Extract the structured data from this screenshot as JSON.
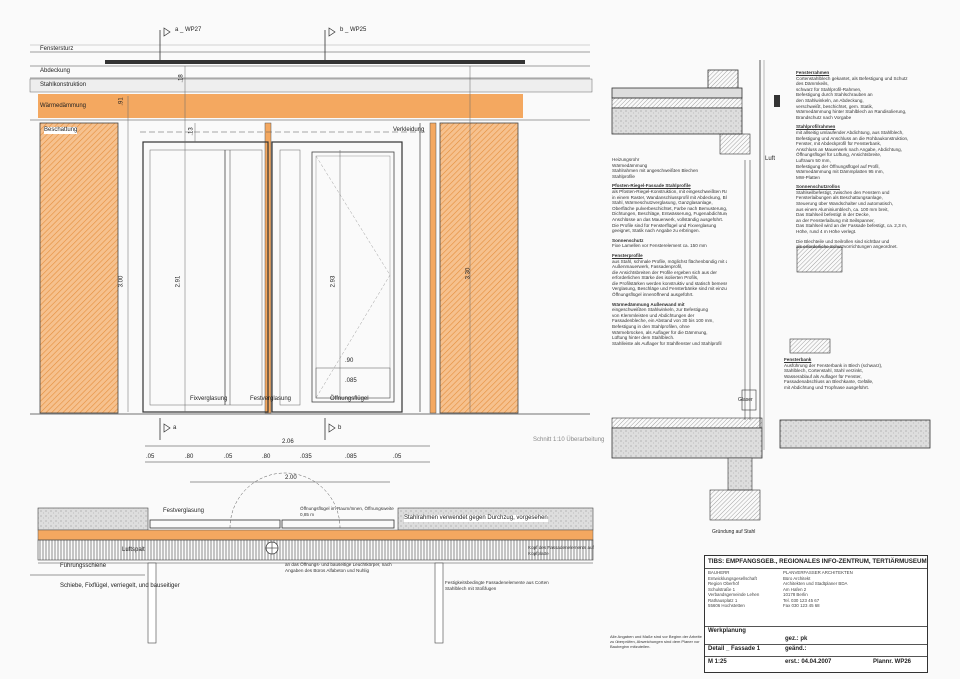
{
  "elevation": {
    "section_marks": [
      "a _ WP27",
      "b _ WP25"
    ],
    "layers": {
      "fenstersturz": "Fenstersturz",
      "abdeckung": "Abdeckung",
      "stahlkonstruktion": "Stahlkonstruktion",
      "daemmung": "Wärmedämmung",
      "beschattung": "Beschattung"
    },
    "labels": {
      "verkleidung": "Verkleidung",
      "verglasung_left": "Fixverglasung",
      "verglasung_mid": "Festverglasung",
      "oeffnungsfluegel": "Öffnungsflügel",
      "detail_ref": "Schnitt 1:10 Überarbeitung",
      "bottom_mark_a": "a",
      "bottom_mark_b": "b"
    },
    "dims_vertical": [
      ".91",
      ".18",
      ".13",
      "3.00",
      "2.91",
      "2.93",
      "3.30"
    ],
    "dims_small": [
      ".90",
      ".085"
    ],
    "dim_total": "2.06",
    "dims_row": [
      ".05",
      ".80",
      ".05",
      ".80",
      ".035",
      ".085",
      ".05"
    ],
    "dim_row2": "2.00"
  },
  "plan": {
    "labels": {
      "festverglasung": "Festverglasung",
      "fluegel": "Öffnungsflügel im Raum/Innen, Öffnungsweite 0,85 m",
      "stahlrahmen": "Stahlrahmen verwendet gegen Durchzug, vorgesehen",
      "fuehrungsschiene": "Führungsschiene",
      "luftspalt": "Luftspalt",
      "schiebe": "Schiebe, Fixflügel, verriegelt, und bauseitiger",
      "deckenleuchten": "an das Öffnungs- und bauseitige Leuchtkörper, nach Angaben des Büros Alfabeton und Nuhlig",
      "fassade": "Festigkeitsbedingte Fassadenelemente aus Corten Stahlblech mit Stoßfugen",
      "kopfbeschlag": "Kopf des Fassadenelements auf Kopfplatte"
    }
  },
  "section": {
    "left_notes": {
      "h1": "Heizungsrohr",
      "h2": "Wärmedämmung",
      "h3": "Stahlrahmen mit angeschweißten Blechen",
      "h4": "Stahlprofile",
      "p1_title": "Pfosten-Riegel-Fassade Stahlprofile",
      "p1": [
        "als Pfosten-Riegel-Konstruktion, mit eingeschweißten Rahmenprofilen,",
        "in einem Raster, Wandanschlussprofil mit Abdeckung, Blechen,",
        "Stahl, Wärmeschutzverglasung, Ganzglasanlage,",
        "Oberfläche pulverbeschichtet, Farbe nach Bemusterung,",
        "Dichtungen, Beschläge, Entwässerung, Fugenabdichtung und",
        "Anschlüsse an das Mauerwerk, vollständig ausgeführt.",
        "Die Profile sind für Fensterflügel und Fixverglasung",
        "geeignet, Statik nach Angabe zu erbringen."
      ],
      "p2_title": "Sonnenschutz",
      "p2": [
        "Fixe Lamellen vor Fensterelement ca. 150 mm"
      ],
      "p3_title": "Fensterprofile",
      "p3": [
        "aus Stahl, schmale Profile, möglichst flächenbündig mit dem",
        "Außenmauerwerk, Fassadenprofil,",
        "die Ansichtsbreiten der Profile ergeben sich aus der",
        "erforderlichen Stärke des isolierten Profils,",
        "die Profilstärken werden konstruktiv und statisch bemessen,",
        "Verglasung, Beschläge und Fensterbänke sind mit einzubauen,",
        "Öffnungsflügel innenöffnend ausgeführt."
      ],
      "p4_title": "Wärmedämmung Außenwand mit",
      "p4": [
        "eingeschweißten Stahlwinkeln, zur Befestigung",
        "von Klemmleisten und Abdichtungen der",
        "Fassadenbleche, ein Abstand von 30 bis 100 mm,",
        "Befestigung in den Stahlprofilen, ohne",
        "Wärmebrücken, als Auflager für die Dämmung,",
        "Lüftung hinter dem Stahlblech.",
        "Stahlleiste als Auflager für Stahlfenster und Stahlprofil"
      ]
    },
    "right_notes": {
      "r1_title": "Fensterrahmen",
      "r1": [
        "Cortenstahlblech gekantet, als Befestigung und Schutz",
        "des Dämmkeils,",
        "schwarz für Stahlprofil-Rahmen,",
        "Befestigung durch Stahlschrauben an",
        "den Stahlwinkeln, an Abdeckung,",
        "verschweißt, beschichtet, gem. Statik,",
        "Wärmedämmung hinter Stahlblech an Randisolierung,",
        "Brandschutz nach Vorgabe"
      ],
      "r2_title": "Stahlprofilrahmen",
      "r2": [
        "mit allseitig umlaufender Abdichtung, aus Stahlblech,",
        "Befestigung und Anschluss an die Rohbaukonstruktion,",
        "Fenster, mit Abdeckprofil für Fensterbank,",
        "Anschluss an Mauerwerk nach Angabe, Abdichtung,",
        "Öffnungsflügel für Lüftung, Ansichtsbreite,",
        "Luftraum 50 mm,",
        "Befestigung der Öffnungsflügel auf Profil,",
        "Wärmedämmung mit Dämmplatten 95 mm,",
        "MW-Platten"
      ],
      "r3_title": "Sonnenschutzrollos",
      "r3": [
        "Stahlseilbefestigt, zwischen den Fenstern und",
        "Fensterlaibungen als Beschattungsanlage,",
        "Steuerung über Wandschalter und automatisch,",
        "aus einem Aluminiumblech, ca. 100 mm breit,",
        "Das Stahlseil befestigt in der Decke,",
        "an der Fensterlaibung mit Seilspanner,",
        "Das Stahlseil wird an der Fassade befestigt, ca. 2,3 m,",
        "Höhe, rund 4 m Höhe verlegt."
      ],
      "r4": [
        "Die Blechteile und Seilrollen sind sichtbar und",
        "als erforderliche Schutzvorrichtungen angeordnet."
      ],
      "r5_title": "Fensterbank",
      "r5": [
        "Ausführung der Fensterbank in Blech (schwarz),",
        "Stahlblech, Cortenstahl, Stahl verzinkt,",
        "Wasserablauf als Auflager für Fenster,",
        "Fassadenabschluss an Blechkante, Gefälle,",
        "mit Abdichtung und Tropfnase ausgeführt."
      ],
      "luft": "Luft",
      "gruendung": "Gründung auf Stahl",
      "glaser": "Glaser"
    }
  },
  "title_block": {
    "project": "TIBS: EMPFANGSGEB., REGIONALES INFO-ZENTRUM, TERTIÄRMUSEUM",
    "client_label": "BAUHERR",
    "client": [
      "Entwicklungsgesellschaft",
      "Region Oberhöf",
      "Schulstraße 1",
      "Verbandsgemeinde Lehen",
      "Rathausplatz 1",
      "55606 Hochstetten"
    ],
    "architect_label": "PLANVERFASSER ARCHITEKTEN",
    "architect": [
      "Büro Architekt",
      "Architekten und Stadtplaner BDA",
      "Am Hafen 2",
      "10178 Berlin",
      "Tel. 030 123 45 67",
      "Fax 030 123 45 68"
    ],
    "phase": "Werkplanung",
    "drawn": "gez.: pk",
    "detail": "Detail _ Fassade 1",
    "changed": "geänd.:",
    "scale": "M 1:25",
    "created": "erst.: 04.04.2007",
    "plan_no": "Plannr. WP26",
    "footnote": [
      "Alle Angaben und Maße sind vor Beginn der Arbeiten am Bau",
      "zu überprüfen, Abweichungen sind dem Planer vor",
      "Baubeginn mitzuteilen."
    ]
  },
  "colors": {
    "orange": "#f4a860",
    "hatch": "#e8a86a",
    "line": "#333333"
  }
}
